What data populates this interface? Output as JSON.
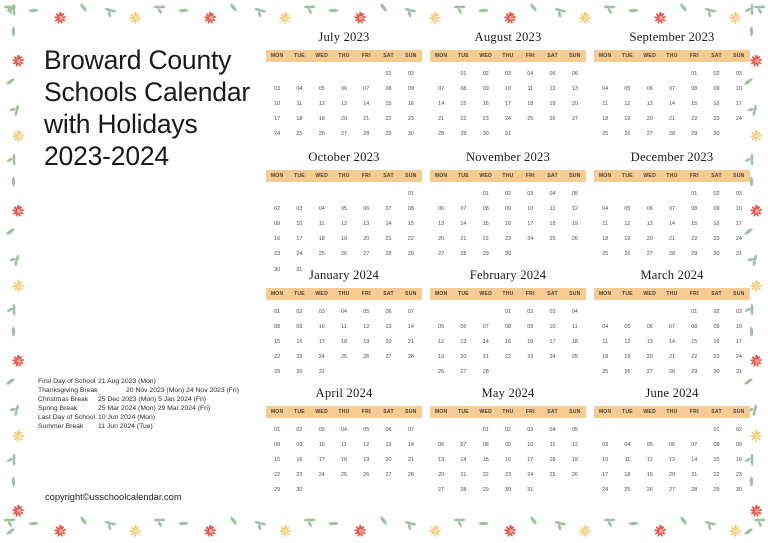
{
  "title": "Broward County Schools Calendar with Holidays 2023-2024",
  "title_lines": [
    "Broward County",
    "Schools Calendar",
    "with Holidays",
    "2023-2024"
  ],
  "copyright": "copyright©usschoolcalendar.com",
  "colors": {
    "header_bar": "#F7CC92",
    "header_text": "#4a4038",
    "day_text": "#4a4a4a",
    "title_text": "#1a1a1a",
    "flower_red": "#e8574a",
    "flower_yellow": "#f6cf7e",
    "leaf_green": "#9dc3a3"
  },
  "legend": {
    "rows": [
      {
        "label": "First Day of School",
        "value": "21 Aug 2023 (Mon)"
      },
      {
        "label": "Thanksgiving Break",
        "value": "20 Nov 2023 (Mon) 24 Nov 2023 (Fri)"
      },
      {
        "label": "Christmas Break",
        "value": "25 Dec 2023 (Mon) 5 Jan 2024 (Fri)"
      },
      {
        "label": "Spring Break",
        "value": "25 Mar 2024 (Mon) 29 Mar 2024 (Fri)"
      },
      {
        "label": "Last Day of School",
        "value": "10 Jun 2024 (Mon)"
      },
      {
        "label": "Summer Break",
        "value": "11 Jun 2024 (Tue)"
      }
    ]
  },
  "weekdays": [
    "MON",
    "TUE",
    "WED",
    "THU",
    "FRI",
    "SAT",
    "SUN"
  ],
  "months": [
    {
      "name": "July 2023",
      "lead_blanks": 5,
      "days": [
        "01",
        "02",
        "03",
        "04",
        "05",
        "06",
        "07",
        "08",
        "09",
        "10",
        "11",
        "12",
        "13",
        "14",
        "15",
        "16",
        "17",
        "18",
        "19",
        "20",
        "21",
        "22",
        "23",
        "24",
        "25",
        "26",
        "27",
        "28",
        "29",
        "30"
      ]
    },
    {
      "name": "August 2023",
      "lead_blanks": 1,
      "days": [
        "01",
        "02",
        "03",
        "04",
        "05",
        "06",
        "07",
        "08",
        "09",
        "10",
        "11",
        "12",
        "13",
        "14",
        "15",
        "16",
        "17",
        "18",
        "19",
        "20",
        "21",
        "22",
        "23",
        "24",
        "25",
        "26",
        "27",
        "28",
        "29",
        "30",
        "31"
      ]
    },
    {
      "name": "September 2023",
      "lead_blanks": 4,
      "days": [
        "01",
        "02",
        "03",
        "04",
        "05",
        "06",
        "07",
        "08",
        "09",
        "10",
        "11",
        "12",
        "13",
        "14",
        "15",
        "16",
        "17",
        "18",
        "19",
        "20",
        "21",
        "22",
        "23",
        "24",
        "25",
        "26",
        "27",
        "28",
        "29",
        "30"
      ]
    },
    {
      "name": "October 2023",
      "lead_blanks": 6,
      "days": [
        "01",
        "02",
        "03",
        "04",
        "05",
        "06",
        "07",
        "08",
        "09",
        "10",
        "11",
        "12",
        "13",
        "14",
        "15",
        "16",
        "17",
        "18",
        "19",
        "20",
        "21",
        "22",
        "23",
        "24",
        "25",
        "26",
        "27",
        "28",
        "29",
        "30",
        "31"
      ]
    },
    {
      "name": "November 2023",
      "lead_blanks": 2,
      "days": [
        "01",
        "02",
        "03",
        "04",
        "05",
        "06",
        "07",
        "08",
        "09",
        "10",
        "11",
        "12",
        "13",
        "14",
        "15",
        "16",
        "17",
        "18",
        "19",
        "20",
        "21",
        "22",
        "23",
        "24",
        "25",
        "26",
        "27",
        "28",
        "29",
        "30"
      ]
    },
    {
      "name": "December 2023",
      "lead_blanks": 4,
      "days": [
        "01",
        "02",
        "03",
        "04",
        "05",
        "06",
        "07",
        "08",
        "09",
        "10",
        "11",
        "12",
        "13",
        "14",
        "15",
        "16",
        "17",
        "18",
        "19",
        "20",
        "21",
        "22",
        "23",
        "24",
        "25",
        "26",
        "27",
        "28",
        "29",
        "30",
        "31"
      ]
    },
    {
      "name": "January 2024",
      "lead_blanks": 0,
      "days": [
        "01",
        "02",
        "03",
        "04",
        "05",
        "06",
        "07",
        "08",
        "09",
        "10",
        "11",
        "12",
        "13",
        "14",
        "15",
        "16",
        "17",
        "18",
        "19",
        "20",
        "21",
        "22",
        "23",
        "24",
        "25",
        "26",
        "27",
        "28",
        "29",
        "30",
        "31"
      ]
    },
    {
      "name": "February 2024",
      "lead_blanks": 3,
      "days": [
        "01",
        "02",
        "03",
        "04",
        "05",
        "06",
        "07",
        "08",
        "09",
        "10",
        "11",
        "12",
        "13",
        "14",
        "15",
        "16",
        "17",
        "18",
        "19",
        "20",
        "21",
        "22",
        "23",
        "24",
        "25",
        "26",
        "27",
        "28"
      ]
    },
    {
      "name": "March 2024",
      "lead_blanks": 4,
      "days": [
        "01",
        "02",
        "03",
        "04",
        "05",
        "06",
        "07",
        "08",
        "09",
        "10",
        "11",
        "12",
        "13",
        "14",
        "15",
        "16",
        "17",
        "18",
        "19",
        "20",
        "21",
        "22",
        "23",
        "24",
        "25",
        "26",
        "27",
        "28",
        "29",
        "30",
        "31"
      ]
    },
    {
      "name": "April 2024",
      "lead_blanks": 0,
      "days": [
        "01",
        "02",
        "03",
        "04",
        "05",
        "06",
        "07",
        "08",
        "09",
        "10",
        "11",
        "12",
        "13",
        "14",
        "15",
        "16",
        "17",
        "18",
        "19",
        "20",
        "21",
        "22",
        "23",
        "24",
        "25",
        "26",
        "27",
        "28",
        "29",
        "30"
      ]
    },
    {
      "name": "May 2024",
      "lead_blanks": 2,
      "days": [
        "01",
        "02",
        "03",
        "04",
        "05",
        "06",
        "07",
        "08",
        "09",
        "10",
        "11",
        "12",
        "13",
        "14",
        "15",
        "16",
        "17",
        "18",
        "19",
        "20",
        "21",
        "22",
        "23",
        "24",
        "25",
        "26",
        "27",
        "28",
        "29",
        "30",
        "31"
      ]
    },
    {
      "name": "June 2024",
      "lead_blanks": 5,
      "days": [
        "01",
        "02",
        "03",
        "04",
        "05",
        "06",
        "07",
        "08",
        "09",
        "10",
        "11",
        "12",
        "13",
        "14",
        "15",
        "16",
        "17",
        "18",
        "19",
        "20",
        "21",
        "22",
        "23",
        "24",
        "25",
        "26",
        "27",
        "28",
        "29",
        "30"
      ]
    }
  ]
}
